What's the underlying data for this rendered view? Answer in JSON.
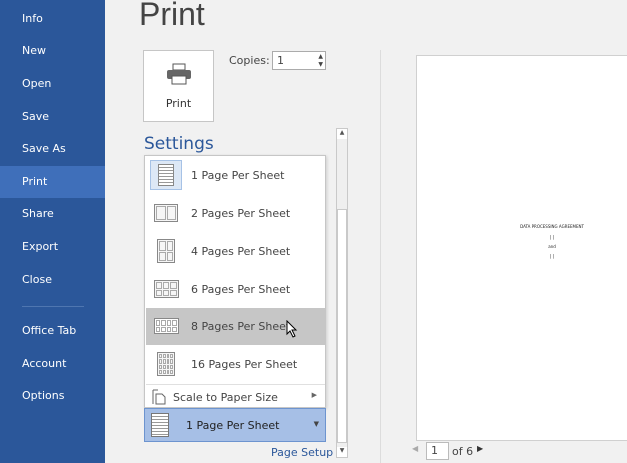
{
  "sidebar": {
    "items": [
      {
        "label": "Info"
      },
      {
        "label": "New"
      },
      {
        "label": "Open"
      },
      {
        "label": "Save"
      },
      {
        "label": "Save As"
      },
      {
        "label": "Print",
        "selected": true
      },
      {
        "label": "Share"
      },
      {
        "label": "Export"
      },
      {
        "label": "Close"
      },
      {
        "label": "Office Tab"
      },
      {
        "label": "Account"
      },
      {
        "label": "Options"
      }
    ]
  },
  "title": "Print",
  "print_button": {
    "label": "Print",
    "icon": "printer-icon"
  },
  "copies": {
    "label": "Copies:",
    "value": "1"
  },
  "settings": {
    "heading": "Settings"
  },
  "menu": {
    "items": [
      {
        "label": "1 Page Per Sheet",
        "state": "current"
      },
      {
        "label": "2 Pages Per Sheet"
      },
      {
        "label": "4 Pages Per Sheet"
      },
      {
        "label": "6 Pages Per Sheet"
      },
      {
        "label": "8 Pages Per Sheet",
        "state": "hover"
      },
      {
        "label": "16 Pages Per Sheet"
      }
    ],
    "scale": "Scale to Paper Size"
  },
  "selected_option": "1 Page Per Sheet",
  "page_setup": "Page Setup",
  "preview": {
    "doc_title": "DATA PROCESSING AGREEMENT",
    "line1": "[          ]",
    "line2": "and",
    "line3": "[          ]"
  },
  "pager": {
    "current": "1",
    "total_label": "of 6"
  },
  "colors": {
    "sidebar": "#2b579a",
    "selected_nav": "#3f6fba",
    "accent": "#2b579a",
    "selected_box": "#a6bfe6"
  }
}
